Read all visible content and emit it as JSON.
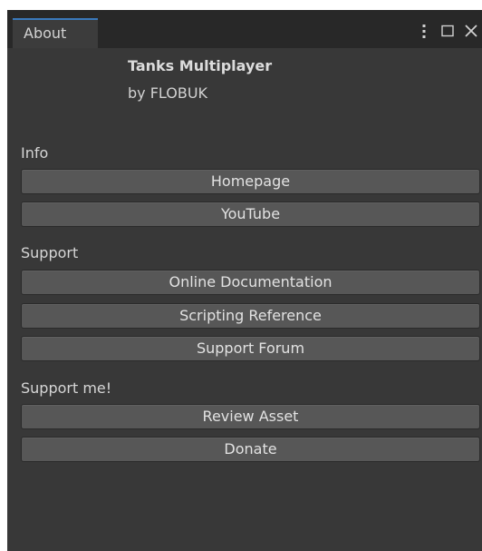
{
  "window": {
    "tab_label": "About",
    "icons": [
      "kebab-menu-icon",
      "maximize-icon",
      "close-icon"
    ]
  },
  "header": {
    "app_title": "Tanks Multiplayer",
    "author": "by FLOBUK"
  },
  "sections": {
    "info": {
      "label": "Info",
      "homepage": "Homepage",
      "youtube": "YouTube"
    },
    "support": {
      "label": "Support",
      "online_docs": "Online Documentation",
      "scripting_ref": "Scripting Reference",
      "support_forum": "Support Forum"
    },
    "support_me": {
      "label": "Support me!",
      "review_asset": "Review Asset",
      "donate": "Donate"
    }
  },
  "colors": {
    "window_bg": "#383838",
    "titlebar_bg": "#282828",
    "tab_accent": "#3a79bb",
    "button_bg": "#575757"
  }
}
